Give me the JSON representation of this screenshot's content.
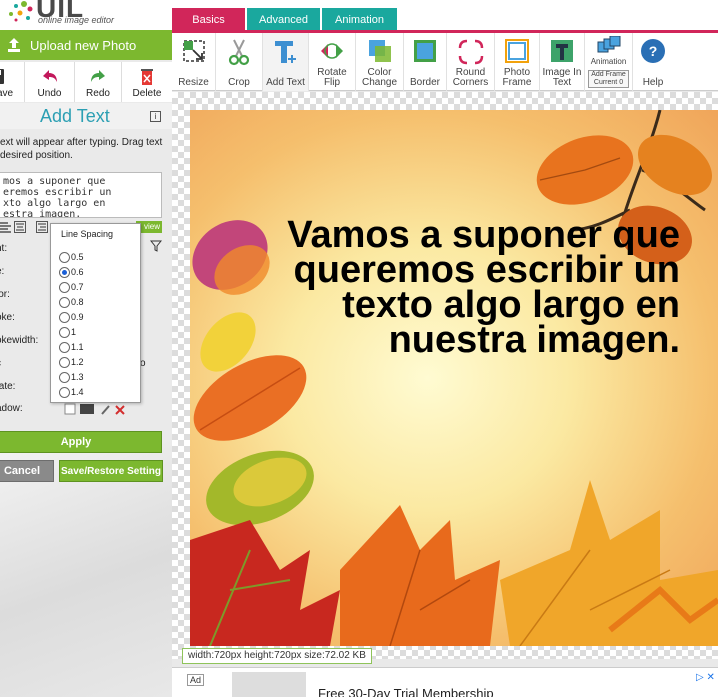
{
  "logo": {
    "text": "UIL",
    "subtitle": "online image editor"
  },
  "left_panel": {
    "upload_label": "Upload new Photo",
    "actions": {
      "save": "ave",
      "undo": "Undo",
      "redo": "Redo",
      "delete": "Delete"
    },
    "header": "Add Text",
    "hint": "ext will appear after typing. Drag text\n desired position.",
    "textarea_value": "mos a suponer que\neremos escribir un\nxto algo largo en\nestra imagen.",
    "preview_label": "view",
    "props": {
      "font": "nt:",
      "size": "e:",
      "color": "lor:",
      "stroke": "oke:",
      "strokewidth": "okewidth:",
      "c": "c",
      "rotate": "tate:",
      "shadow": "adow:",
      "trailing_o": "o"
    },
    "apply_label": "Apply",
    "cancel_label": "Cancel",
    "save_restore_label": "Save/Restore Setting"
  },
  "line_spacing": {
    "title": "Line Spacing",
    "options": [
      "0.5",
      "0.6",
      "0.7",
      "0.8",
      "0.9",
      "1",
      "1.1",
      "1.2",
      "1.3",
      "1.4"
    ],
    "selected": "0.6"
  },
  "tabs": {
    "basics": "Basics",
    "advanced": "Advanced",
    "animation": "Animation"
  },
  "toolbar": {
    "resize": "Resize",
    "crop": "Crop",
    "add_text": "Add Text",
    "rotate_flip_1": "Rotate",
    "rotate_flip_2": "Flip",
    "color_change_1": "Color",
    "color_change_2": "Change",
    "border": "Border",
    "round_corners_1": "Round",
    "round_corners_2": "Corners",
    "photo_frame_1": "Photo",
    "photo_frame_2": "Frame",
    "image_in_text_1": "Image In",
    "image_in_text_2": "Text",
    "animation": "Animation",
    "add_frame": "Add Frame",
    "current": "Current 0",
    "help": "Help"
  },
  "canvas": {
    "overlay_lines": [
      "Vamos a suponer que",
      "queremos escribir un",
      "texto algo largo en",
      "nuestra imagen."
    ]
  },
  "status": {
    "size_info": "width:720px  height:720px  size:72.02 KB"
  },
  "ad": {
    "label": "Ad",
    "title": "Free 30-Day Trial Membership",
    "close": "▷ ✕"
  },
  "colors": {
    "green": "#7cb82f",
    "magenta": "#d1265a",
    "teal": "#1aa89e",
    "title_blue": "#2b9fb3"
  }
}
